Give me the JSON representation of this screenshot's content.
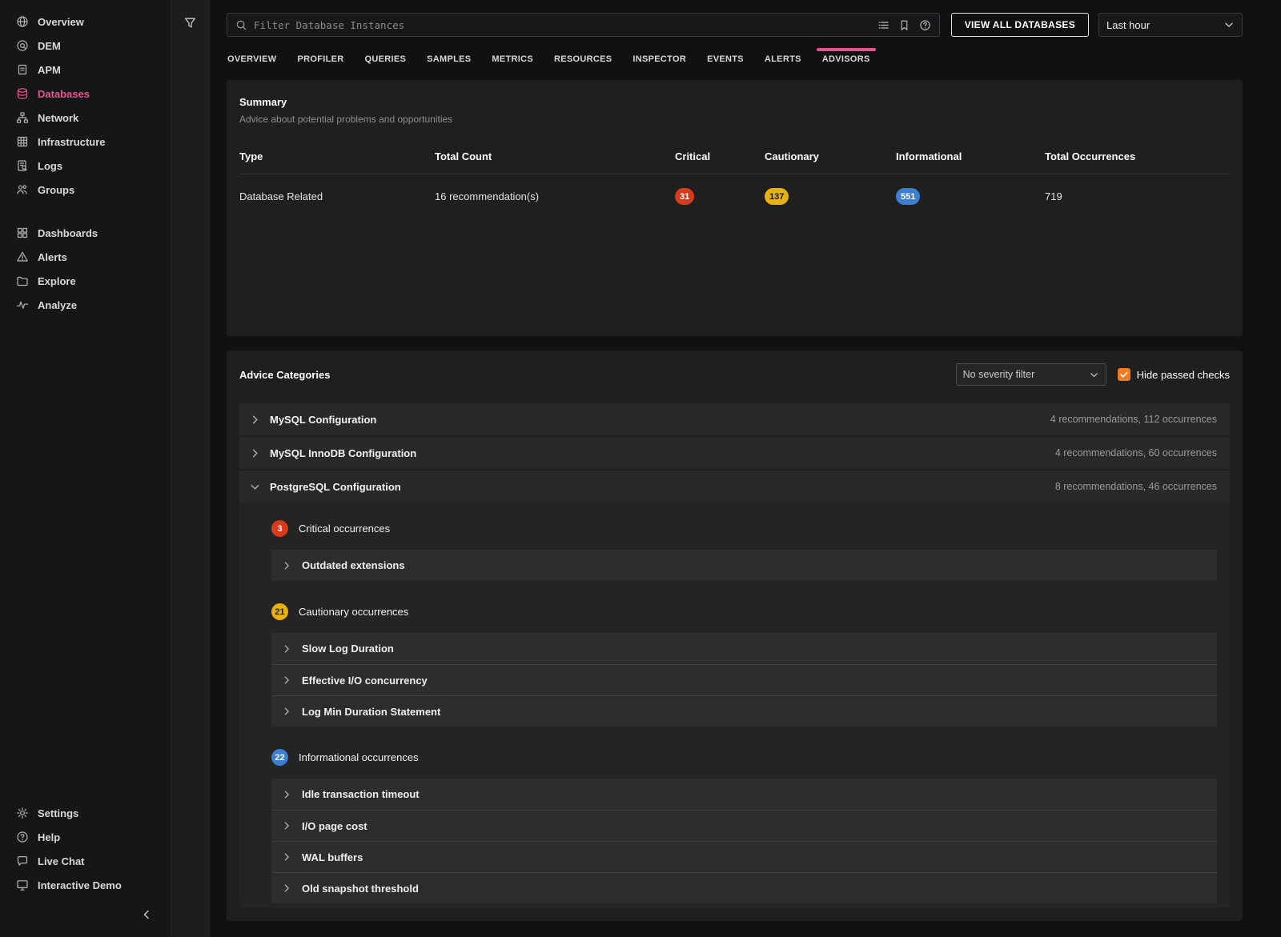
{
  "colors": {
    "accent": "#e8538f",
    "critical": "#d93a1a",
    "cautionary": "#e9b10e",
    "informational": "#3b7fd4",
    "checkbox": "#ef7d1f"
  },
  "sidebar": {
    "primary": [
      {
        "label": "Overview"
      },
      {
        "label": "DEM"
      },
      {
        "label": "APM"
      },
      {
        "label": "Databases"
      },
      {
        "label": "Network"
      },
      {
        "label": "Infrastructure"
      },
      {
        "label": "Logs"
      },
      {
        "label": "Groups"
      }
    ],
    "secondary": [
      {
        "label": "Dashboards"
      },
      {
        "label": "Alerts"
      },
      {
        "label": "Explore"
      },
      {
        "label": "Analyze"
      }
    ],
    "footer": [
      {
        "label": "Settings"
      },
      {
        "label": "Help"
      },
      {
        "label": "Live Chat"
      },
      {
        "label": "Interactive Demo"
      }
    ]
  },
  "topbar": {
    "search_placeholder": "Filter Database Instances",
    "view_all_label": "VIEW ALL DATABASES",
    "time_range": "Last hour"
  },
  "tabs": [
    {
      "label": "OVERVIEW"
    },
    {
      "label": "PROFILER"
    },
    {
      "label": "QUERIES"
    },
    {
      "label": "SAMPLES"
    },
    {
      "label": "METRICS"
    },
    {
      "label": "RESOURCES"
    },
    {
      "label": "INSPECTOR"
    },
    {
      "label": "EVENTS"
    },
    {
      "label": "ALERTS"
    },
    {
      "label": "ADVISORS",
      "active": true
    }
  ],
  "summary": {
    "title": "Summary",
    "subtitle": "Advice about potential problems and opportunities",
    "columns": [
      "Type",
      "Total Count",
      "Critical",
      "Cautionary",
      "Informational",
      "Total Occurrences"
    ],
    "row": {
      "type": "Database Related",
      "total_count": "16 recommendation(s)",
      "critical": "31",
      "cautionary": "137",
      "informational": "551",
      "total_occurrences": "719"
    }
  },
  "advice": {
    "title": "Advice Categories",
    "severity_filter": "No severity filter",
    "hide_passed_label": "Hide passed checks",
    "hide_passed_checked": true,
    "categories": [
      {
        "label": "MySQL Configuration",
        "summary": "4 recommendations, 112 occurrences",
        "expanded": false
      },
      {
        "label": "MySQL InnoDB Configuration",
        "summary": "4 recommendations, 60 occurrences",
        "expanded": false
      },
      {
        "label": "PostgreSQL Configuration",
        "summary": "8 recommendations, 46 occurrences",
        "expanded": true,
        "groups": [
          {
            "badge": "3",
            "severity": "critical",
            "label": "Critical occurrences",
            "items": [
              {
                "label": "Outdated extensions"
              }
            ]
          },
          {
            "badge": "21",
            "severity": "cautionary",
            "label": "Cautionary occurrences",
            "items": [
              {
                "label": "Slow Log Duration"
              },
              {
                "label": "Effective I/O concurrency"
              },
              {
                "label": "Log Min Duration Statement"
              }
            ]
          },
          {
            "badge": "22",
            "severity": "informational",
            "label": "Informational occurrences",
            "items": [
              {
                "label": "Idle transaction timeout"
              },
              {
                "label": "I/O page cost"
              },
              {
                "label": "WAL buffers"
              },
              {
                "label": "Old snapshot threshold"
              }
            ]
          }
        ]
      }
    ]
  }
}
